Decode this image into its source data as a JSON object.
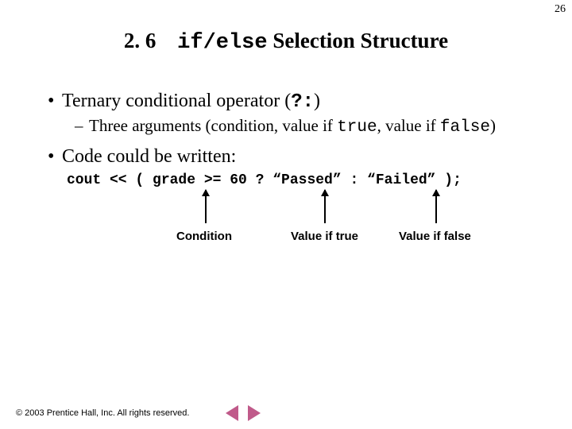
{
  "page_number": "26",
  "title": {
    "section_number": "2. 6",
    "code_part": "if/else",
    "rest": " Selection Structure"
  },
  "bullets": {
    "b1a_pre": "Ternary conditional operator (",
    "b1a_code": "?:",
    "b1a_post": ")",
    "b2a_pre": "Three arguments (condition, value if ",
    "b2a_true": "true",
    "b2a_mid": ", value if ",
    "b2a_false": "false",
    "b2a_post": ")",
    "b1b": "Code could be written:"
  },
  "code_line": "cout << ( grade >= 60 ? “Passed” : “Failed” );",
  "labels": {
    "condition": "Condition",
    "value_true": "Value if true",
    "value_false": "Value if false"
  },
  "footer": "© 2003 Prentice Hall, Inc.  All rights reserved."
}
